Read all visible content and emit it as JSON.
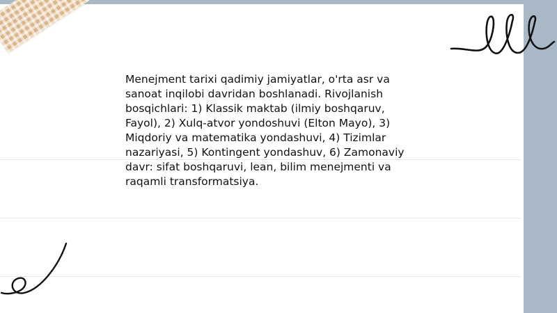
{
  "content": {
    "paragraph": "Menejment tarixi qadimiy jamiyatlar, o'rta asr va sanoat inqilobi davridan boshlanadi. Rivojlanish bosqichlari: 1) Klassik maktab (ilmiy boshqaruv, Fayol), 2) Xulq-atvor yondoshuvi (Elton Mayo), 3) Miqdoriy va matematika yondashuvi, 4) Tizimlar nazariyasi, 5) Kontingent yondashuv, 6) Zamonaviy davr: sifat boshqaruvi, lean, bilim menejmenti va raqamli transformatsiya."
  },
  "colors": {
    "background": "#a9b8c7",
    "paper": "#ffffff",
    "tape": "#d9b688",
    "ink": "#111111"
  },
  "decorations": [
    "washi-tape",
    "scribble-loops",
    "scribble-curl"
  ]
}
